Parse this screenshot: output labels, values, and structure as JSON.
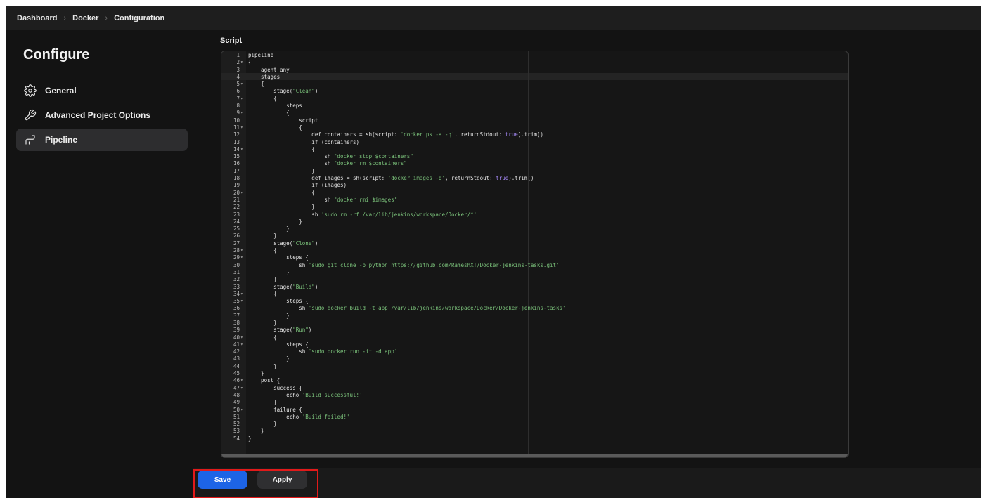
{
  "breadcrumb": {
    "items": [
      "Dashboard",
      "Docker",
      "Configuration"
    ],
    "separator": "›"
  },
  "sidebar": {
    "title": "Configure",
    "items": [
      {
        "label": "General",
        "icon": "gear-icon"
      },
      {
        "label": "Advanced Project Options",
        "icon": "wrench-icon"
      },
      {
        "label": "Pipeline",
        "icon": "pipeline-icon",
        "active": true
      }
    ]
  },
  "editor": {
    "label": "Script",
    "active_line": 4,
    "lines": [
      "pipeline",
      "{",
      "    agent any",
      "    stages",
      "    {",
      "        stage(\"Clean\")",
      "        {",
      "            steps",
      "            {",
      "                script",
      "                {",
      "                    def containers = sh(script: 'docker ps -a -q', returnStdout: true).trim()",
      "                    if (containers)",
      "                    {",
      "                        sh \"docker stop $containers\"",
      "                        sh \"docker rm $containers\"",
      "                    }",
      "                    def images = sh(script: 'docker images -q', returnStdout: true).trim()",
      "                    if (images)",
      "                    {",
      "                        sh \"docker rmi $images\"",
      "                    }",
      "                    sh 'sudo rm -rf /var/lib/jenkins/workspace/Docker/*'",
      "                }",
      "            }",
      "        }",
      "        stage(\"Clone\")",
      "        {",
      "            steps {",
      "                sh 'sudo git clone -b python https://github.com/RameshXT/Docker-jenkins-tasks.git'",
      "            }",
      "        }",
      "        stage(\"Build\")",
      "        {",
      "            steps {",
      "                sh 'sudo docker build -t app /var/lib/jenkins/workspace/Docker/Docker-jenkins-tasks'",
      "            }",
      "        }",
      "        stage(\"Run\")",
      "        {",
      "            steps {",
      "                sh 'sudo docker run -it -d app'",
      "            }",
      "        }",
      "    }",
      "    post {",
      "        success {",
      "            echo 'Build successful!'",
      "        }",
      "        failure {",
      "            echo 'Build failed!'",
      "        }",
      "    }",
      "}"
    ],
    "fold_lines": [
      2,
      5,
      7,
      9,
      11,
      14,
      20,
      28,
      29,
      34,
      35,
      40,
      41,
      46,
      47,
      50
    ]
  },
  "actions": {
    "save_label": "Save",
    "apply_label": "Apply"
  },
  "colors": {
    "accent": "#1d64e6",
    "highlight": "#e11a1a",
    "string": "#7bc27b",
    "keyword": "#a78bfa"
  }
}
